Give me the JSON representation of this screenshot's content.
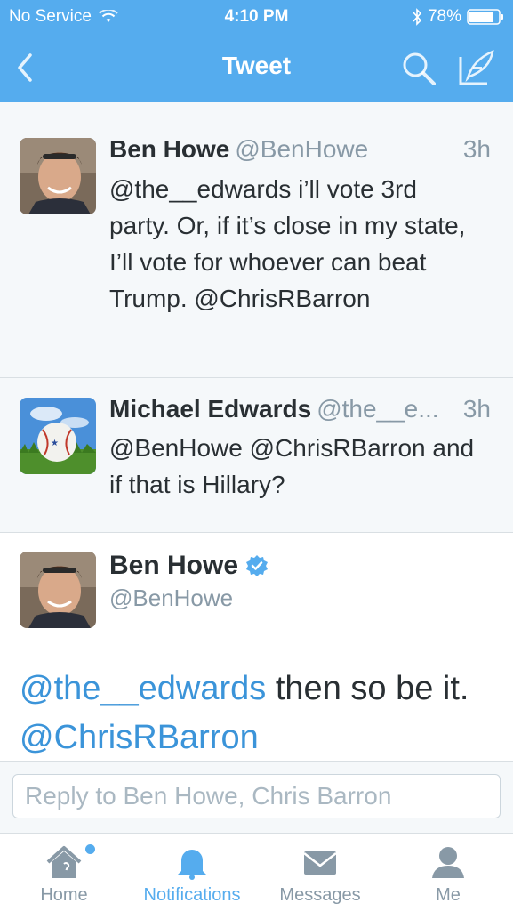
{
  "status_bar": {
    "carrier": "No Service",
    "time": "4:10 PM",
    "battery": "78%"
  },
  "nav": {
    "title": "Tweet"
  },
  "tweets": [
    {
      "name": "Ben Howe",
      "handle": "@BenHowe",
      "time": "3h",
      "text": "@the__edwards i’ll vote 3rd party. Or, if it’s close in my state, I’ll vote for whoever can beat Trump. @ChrisRBarron"
    },
    {
      "name": "Michael Edwards",
      "handle": "@the__e...",
      "time": "3h",
      "text": "@BenHowe @ChrisRBarron and if that is Hillary?"
    }
  ],
  "focused_tweet": {
    "name": "Ben Howe",
    "handle": "@BenHowe",
    "mention1": "@the__edwards",
    "text_mid": " then so be it.",
    "mention2": "@ChrisRBarron"
  },
  "reply": {
    "placeholder": "Reply to Ben Howe, Chris Barron"
  },
  "tabs": [
    {
      "label": "Home",
      "icon": "home-icon"
    },
    {
      "label": "Notifications",
      "icon": "bell-icon"
    },
    {
      "label": "Messages",
      "icon": "envelope-icon"
    },
    {
      "label": "Me",
      "icon": "person-icon"
    }
  ],
  "colors": {
    "accent": "#55acee",
    "link": "#3b94d9",
    "muted": "#8899a6",
    "text": "#292f33"
  }
}
